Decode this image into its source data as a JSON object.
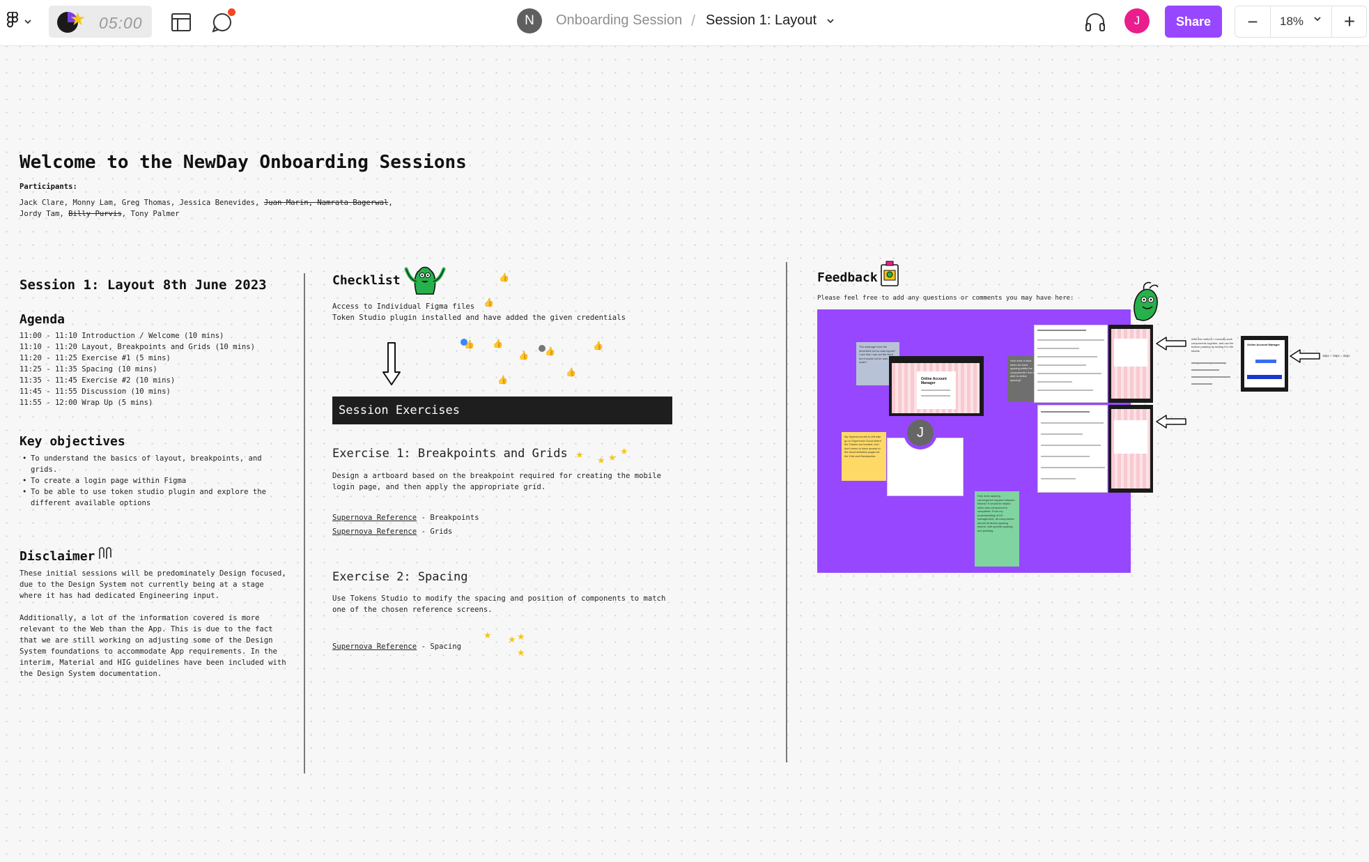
{
  "toolbar": {
    "timer": "05:00",
    "team_initial": "N",
    "project_name": "Onboarding Session",
    "separator": "/",
    "file_name": "Session 1: Layout",
    "user_initial": "J",
    "share_label": "Share",
    "zoom_level": "18%",
    "zoom_minus": "−",
    "zoom_plus": "+",
    "icons": [
      "figma-menu-icon",
      "chevron-down-icon",
      "layout-panel-icon",
      "comment-icon",
      "headphones-icon"
    ],
    "colors": {
      "share": "#9747ff",
      "user_avatar": "#e91e8c",
      "notification": "#f24822"
    }
  },
  "canvas": {
    "title": "Welcome to the NewDay Onboarding Sessions",
    "participants_label": "Participants:",
    "participants": {
      "line1_active": "Jack Clare, Monny Lam, Greg Thomas, Jessica Benevides,",
      "line1_struck": "Juan Marin, Namrata Bagerwal",
      "line1_end": ",",
      "line2_start": "Jordy Tam,",
      "line2_struck": "Billy Purvis",
      "line2_end": ", Tony Palmer"
    },
    "session": {
      "heading": "Session 1: Layout 8th June 2023",
      "agenda_heading": "Agenda",
      "agenda": [
        "11:00 - 11:10 Introduction / Welcome (10 mins)",
        "11:10 - 11:20 Layout, Breakpoints and Grids (10 mins)",
        "11:20 - 11:25 Exercise #1 (5 mins)",
        "11:25 - 11:35 Spacing (10 mins)",
        "11:35 - 11:45 Exercise #2 (10 mins)",
        "11:45 - 11:55 Discussion (10 mins)",
        "11:55 - 12:00 Wrap Up (5 mins)"
      ],
      "objectives_heading": "Key objectives",
      "objectives": [
        "To understand the basics of layout, breakpoints, and\ngrids.",
        "To create a login page within Figma",
        "To be able to use token studio plugin and explore the\ndifferent available options"
      ],
      "disclaimer_heading": "Disclaimer",
      "disclaimer_p1": "These initial sessions will be predominately Design focused,\ndue to the Design System not currently being at a stage\nwhere it has had dedicated Engineering input.",
      "disclaimer_p2": "Additionally, a lot of the information covered is more\nrelevant to the Web than the App. This is due to the fact\nthat we are still working on adjusting some of the Design\nSystem foundations to accommodate App requirements. In the\ninterim, Material and HIG guidelines have been included with\nthe Design System documentation."
    },
    "checklist": {
      "heading": "Checklist",
      "items": [
        "Access to Individual Figma files",
        "Token Studio plugin installed and have added the given credentials"
      ]
    },
    "exercises": {
      "bar_label": "Session Exercises",
      "ex1_title": "Exercise 1: Breakpoints and Grids",
      "ex1_desc": "Design a artboard based on the breakpoint required for creating the mobile\nlogin page, and then apply the appropriate grid.",
      "ex1_links": [
        {
          "link": "Supernova Reference",
          "suffix": " - Breakpoints"
        },
        {
          "link": "Supernova Reference",
          "suffix": " - Grids"
        }
      ],
      "ex2_title": "Exercise 2: Spacing",
      "ex2_desc": "Use Tokens Studio to modify the spacing and position of components to match\none of the chosen reference screens.",
      "ex2_link": {
        "link": "Supernova Reference",
        "suffix": " - Spacing"
      }
    },
    "feedback": {
      "heading": "Feedback",
      "prompt": "Please feel free to add any questions or comments you may have here:",
      "board_avatar": "J",
      "board_color": "#9747ff",
      "sticky_gray": "The webpage from the described but so auto layout? I see that I can set the fixed but it would not be auto-scale?",
      "sticky_yellow": "My Supernova link to left side go to Supernova Cloud where the Tokens are located, but I don't seem to have access to the documentation pages for the Grid and Breakpoints.",
      "sticky_darkgray": "How does it work when we have spacing within the components? Are we able to define spacing?",
      "sticky_green": "How does spacing convergence happen between tokens? It would be helpful when new component is completed. From my understanding of UX management, all components should sit above spacing tokens, with specific spacing and padding.",
      "screen_title": "Online Account Manager",
      "side_note": "With this method, I normally work components together, and use the bottom padding by adding it to the tokens",
      "side_note2": "16px + 16px = 32px"
    }
  }
}
